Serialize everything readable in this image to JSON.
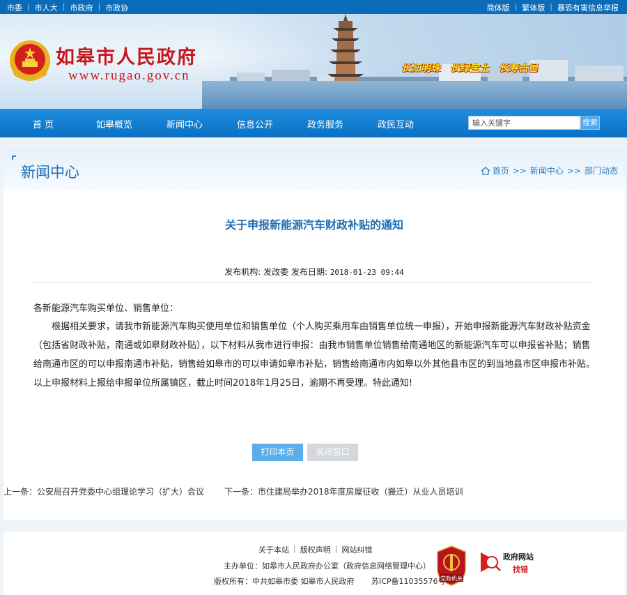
{
  "topbar": {
    "left_links": [
      "市委",
      "市人大",
      "市政府",
      "市政协"
    ],
    "right_links": [
      "简体版",
      "繁体版",
      "暴恐有害信息举报"
    ]
  },
  "banner": {
    "site_title": "如皋市人民政府",
    "domain": "www.rugao.gov.cn",
    "slogans": [
      "长江明珠",
      "长绿宝土",
      "长寿古邑"
    ]
  },
  "nav": {
    "items": [
      "首 页",
      "如皋概览",
      "新闻中心",
      "信息公开",
      "政务服务",
      "政民互动"
    ],
    "search_placeholder": "输入关键字",
    "search_button": "搜索"
  },
  "section": {
    "title": "新闻中心",
    "breadcrumb": [
      "首页",
      "新闻中心",
      "部门动态"
    ]
  },
  "article": {
    "title": "关于申报新能源汽车财政补贴的通知",
    "publisher_label": "发布机构:",
    "publisher": "发改委",
    "date_label": "发布日期:",
    "date": "2018-01-23 09:44",
    "salutation": "各新能源汽车购买单位、销售单位：",
    "body": "根据相关要求，请我市新能源汽车购买使用单位和销售单位（个人购买乘用车由销售单位统一申报），开始申报新能源汽车财政补贴资金（包括省财政补贴，南通或如皋财政补贴），以下材料从我市进行申报：由我市销售单位销售给南通地区的新能源汽车可以申报省补贴；销售给南通市区的可以申报南通市补贴，销售给如皋市的可以申请如皋市补贴，销售给南通市内如皋以外其他县市区的到当地县市区申报市补贴。以上申报材料上报给申报单位所属镇区，截止时间2018年1月25日，逾期不再受理。特此通知!",
    "print_button": "打印本页",
    "close_button": "关闭窗口",
    "prev": "上一条：公安局召开党委中心组理论学习（扩大）会议",
    "next": "下一条：市住建局举办2018年度房屋征收（搬迁）从业人员培训"
  },
  "footer": {
    "links": [
      "关于本站",
      "版权声明",
      "网站纠错"
    ],
    "host": "主办单位：如皋市人民政府办公室（政府信息网络管理中心）",
    "copyright": "版权所有：中共如皋市委  如皋市人民政府",
    "icp": "苏ICP备11035576号",
    "badge1_text": "党政机关",
    "badge2_title": "政府网站",
    "badge2_sub": "找错"
  },
  "colors": {
    "topbar": "#0a6cb8",
    "nav": "#1a86d8",
    "accent_red": "#c8161d",
    "title_blue": "#1f6fb5"
  }
}
